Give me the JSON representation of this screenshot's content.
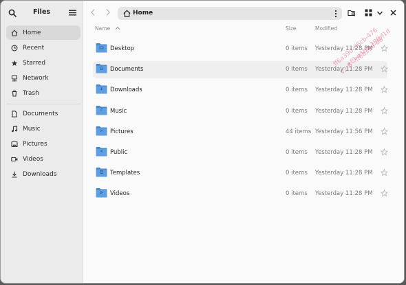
{
  "app": {
    "title": "Files"
  },
  "sidebar": {
    "places": [
      {
        "label": "Home",
        "icon": "home-icon",
        "active": true
      },
      {
        "label": "Recent",
        "icon": "clock-icon"
      },
      {
        "label": "Starred",
        "icon": "star-icon"
      },
      {
        "label": "Network",
        "icon": "network-icon"
      },
      {
        "label": "Trash",
        "icon": "trash-icon"
      }
    ],
    "bookmarks": [
      {
        "label": "Documents",
        "icon": "document-icon"
      },
      {
        "label": "Music",
        "icon": "music-icon"
      },
      {
        "label": "Pictures",
        "icon": "picture-icon"
      },
      {
        "label": "Videos",
        "icon": "video-icon"
      },
      {
        "label": "Downloads",
        "icon": "download-icon"
      }
    ]
  },
  "pathbar": {
    "location": "Home"
  },
  "columns": {
    "name": "Name",
    "size": "Size",
    "modified": "Modified"
  },
  "files": [
    {
      "name": "Desktop",
      "size": "0 items",
      "modified": "Yesterday 11:28 PM"
    },
    {
      "name": "Documents",
      "size": "0 items",
      "modified": "Yesterday 11:28 PM"
    },
    {
      "name": "Downloads",
      "size": "0 items",
      "modified": "Yesterday 11:28 PM"
    },
    {
      "name": "Music",
      "size": "0 items",
      "modified": "Yesterday 11:28 PM"
    },
    {
      "name": "Pictures",
      "size": "44 items",
      "modified": "Yesterday 11:56 PM"
    },
    {
      "name": "Public",
      "size": "0 items",
      "modified": "Yesterday 11:28 PM"
    },
    {
      "name": "Templates",
      "size": "0 items",
      "modified": "Yesterday 11:28 PM"
    },
    {
      "name": "Videos",
      "size": "0 items",
      "modified": "Yesterday 11:28 PM"
    }
  ],
  "watermark": [
    "ff6a39d-d6cb-476",
    "ef9-a4bd-38fbf1d",
    "v2 8 - ff6a39d-d6"
  ],
  "colors": {
    "folder": "#5f9fe0",
    "folder_tab": "#4a86c8",
    "watermark": "#e06080"
  }
}
